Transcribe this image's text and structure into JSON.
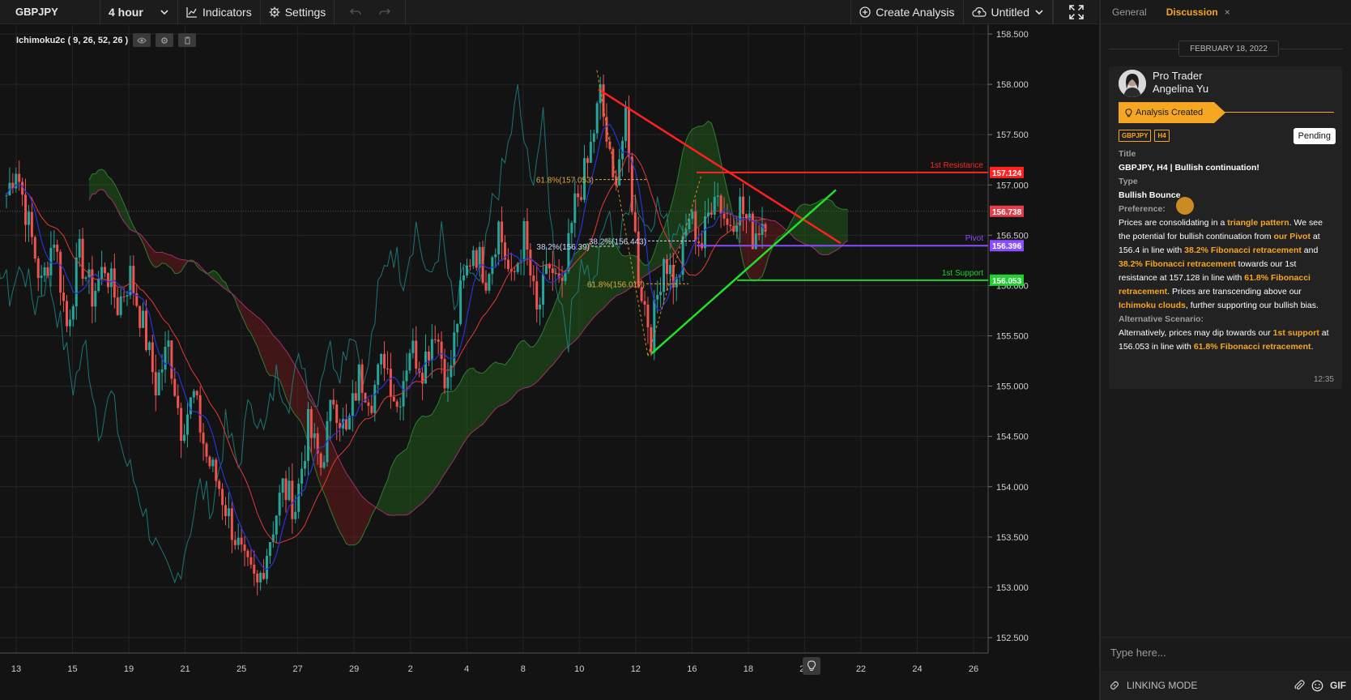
{
  "toolbar": {
    "symbol": "GBPJPY",
    "interval": "4 hour",
    "indicators_label": "Indicators",
    "settings_label": "Settings",
    "create_analysis_label": "Create Analysis",
    "layout_name": "Untitled"
  },
  "indicator": {
    "label": "Ichimoku2c ( 9, 26, 52, 26 )"
  },
  "chart_data": {
    "type": "candlestick",
    "symbol": "GBPJPY",
    "timeframe": "H4",
    "x_tick_labels": [
      "13",
      "15",
      "19",
      "21",
      "25",
      "27",
      "29",
      "2",
      "4",
      "8",
      "10",
      "12",
      "16",
      "18",
      "20",
      "22",
      "24",
      "26"
    ],
    "y_tick_labels": [
      "158.500",
      "158.000",
      "157.500",
      "157.000",
      "156.500",
      "156.000",
      "155.500",
      "155.000",
      "154.500",
      "154.000",
      "153.500",
      "153.000",
      "152.500"
    ],
    "ylim": [
      152.5,
      158.5
    ],
    "grid": true,
    "price_levels": [
      {
        "name": "1st Resistance",
        "value": "157.124",
        "color": "#ff2424"
      },
      {
        "name": "",
        "value": "156.738",
        "color": "#e0404a"
      },
      {
        "name": "Pivot",
        "value": "156.396",
        "color": "#8a4dff"
      },
      {
        "name": "1st Support",
        "value": "156.053",
        "color": "#1fd12e"
      }
    ],
    "fib_labels": [
      "61.8%(157.053)",
      "38.2%(156.39)",
      "38.2%(156.443)",
      "61.8%(156.017)"
    ],
    "close_path": [
      [
        0,
        156.9
      ],
      [
        3,
        157.2
      ],
      [
        7,
        156.6
      ],
      [
        11,
        156.0
      ],
      [
        15,
        156.5
      ],
      [
        19,
        155.6
      ],
      [
        23,
        156.3
      ],
      [
        27,
        155.9
      ],
      [
        31,
        156.2
      ],
      [
        35,
        155.8
      ],
      [
        39,
        156.1
      ],
      [
        43,
        155.6
      ],
      [
        47,
        155.0
      ],
      [
        51,
        155.4
      ],
      [
        55,
        154.6
      ],
      [
        59,
        154.9
      ],
      [
        63,
        154.3
      ],
      [
        67,
        154.0
      ],
      [
        71,
        153.6
      ],
      [
        75,
        153.2
      ],
      [
        79,
        153.0
      ],
      [
        83,
        153.5
      ],
      [
        87,
        154.0
      ],
      [
        91,
        153.8
      ],
      [
        95,
        154.6
      ],
      [
        99,
        154.2
      ],
      [
        103,
        154.9
      ],
      [
        107,
        154.5
      ],
      [
        111,
        155.1
      ],
      [
        115,
        154.9
      ],
      [
        119,
        155.3
      ],
      [
        123,
        154.8
      ],
      [
        127,
        155.4
      ],
      [
        131,
        155.2
      ],
      [
        135,
        155.6
      ],
      [
        139,
        155.0
      ],
      [
        143,
        155.9
      ],
      [
        147,
        156.4
      ],
      [
        151,
        156.1
      ],
      [
        155,
        156.6
      ],
      [
        159,
        156.0
      ],
      [
        163,
        156.5
      ],
      [
        167,
        155.7
      ],
      [
        171,
        156.2
      ],
      [
        175,
        155.9
      ],
      [
        179,
        156.8
      ],
      [
        183,
        157.2
      ],
      [
        187,
        157.9
      ],
      [
        191,
        157.0
      ],
      [
        195,
        157.6
      ],
      [
        199,
        156.1
      ],
      [
        203,
        155.5
      ],
      [
        207,
        156.3
      ],
      [
        211,
        156.0
      ],
      [
        215,
        156.7
      ],
      [
        219,
        156.4
      ],
      [
        223,
        157.0
      ],
      [
        227,
        156.6
      ],
      [
        231,
        156.8
      ],
      [
        235,
        156.5
      ],
      [
        239,
        156.7
      ]
    ]
  },
  "panel": {
    "tab_general": "General",
    "tab_discussion": "Discussion",
    "tab_close": "×",
    "date": "FEBRUARY 18, 2022",
    "author_line1": "Pro Trader",
    "author_line2": "Angelina Yu",
    "status": "Analysis Created",
    "tag_symbol": "GBPJPY",
    "tag_timeframe": "H4",
    "pending": "Pending",
    "title_label": "Title",
    "title": "GBPJPY, H4 | Bullish continuation!",
    "type_label": "Type",
    "type": "Bullish Bounce",
    "preference_label": "Preference:",
    "pref_1": "Prices are consolidating in a ",
    "pref_hl_1": "triangle pattern",
    "pref_2": ". We see the potential for bullish continuation from ",
    "pref_hl_2": "our Pivot",
    "pref_3": " at 156.4 in line with ",
    "pref_hl_3": "38.2% Fibonacci retracement",
    "pref_4": " and ",
    "pref_hl_4": "38.2% Fibonacci retracement",
    "pref_5": " towards our 1st resistance at 157.128 in line with ",
    "pref_hl_5": "61.8% Fibonacci retracement",
    "pref_6": ". Prices are transcending above our ",
    "pref_hl_6": "Ichimoku clouds",
    "pref_7": ", further supporting our bullish bias.",
    "alt_label": "Alternative Scenario:",
    "alt_1": "Alternatively, prices may dip towards our ",
    "alt_hl_1": "1st support",
    "alt_2": " at 156.053 in line with ",
    "alt_hl_2": "61.8% Fibonacci retracement",
    "alt_3": ".",
    "time": "12:35",
    "input_placeholder": "Type here...",
    "linking_mode": "LINKING MODE",
    "gif": "GIF"
  },
  "colors": {
    "accent": "#f5a623",
    "bull": "#26a69a",
    "bear": "#ef5350",
    "resistance": "#ff2424",
    "support": "#1fd12e",
    "pivot": "#8a4dff"
  }
}
